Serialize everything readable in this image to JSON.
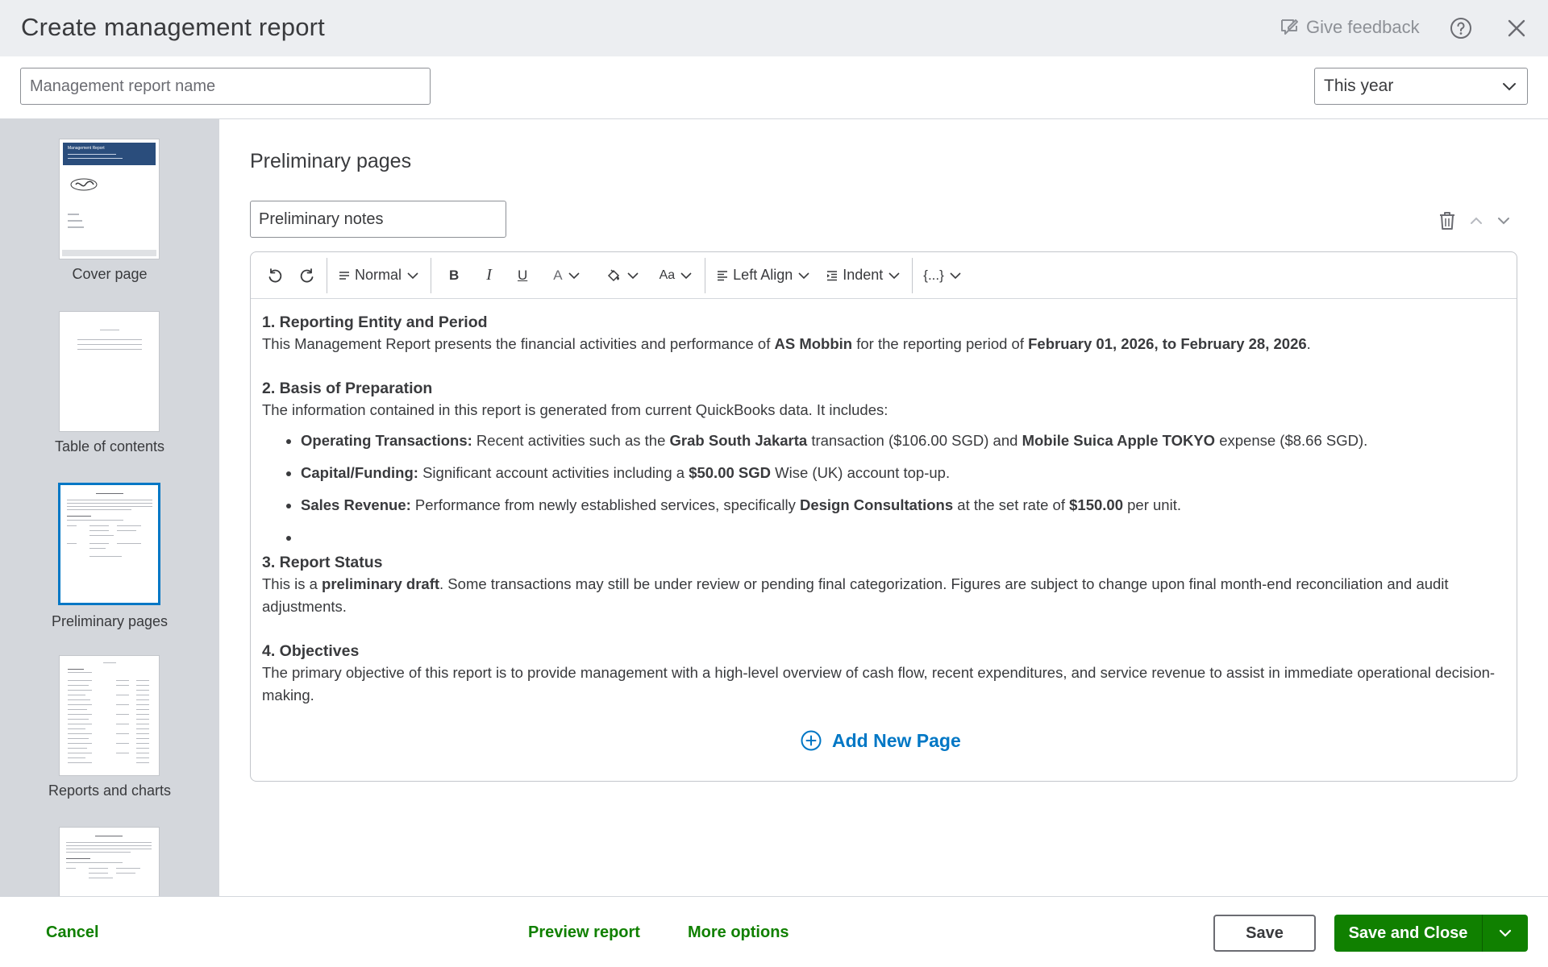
{
  "header": {
    "title": "Create management report",
    "feedback_label": "Give feedback"
  },
  "name_row": {
    "name_placeholder": "Management report name",
    "name_value": "",
    "period_value": "This year"
  },
  "sidebar": {
    "items": [
      {
        "label": "Cover page"
      },
      {
        "label": "Table of contents"
      },
      {
        "label": "Preliminary pages",
        "active": true
      },
      {
        "label": "Reports and charts"
      },
      {
        "label": ""
      }
    ],
    "cover_thumb_title": "Management Report"
  },
  "main": {
    "section_title": "Preliminary pages",
    "page_name_value": "Preliminary notes",
    "toolbar": {
      "style_label": "Normal",
      "bold_label": "B",
      "italic_label": "I",
      "underline_label": "U",
      "font_color_label": "A",
      "font_size_label": "Aa",
      "align_label": "Left Align",
      "indent_label": "Indent",
      "fields_label": "{...}"
    },
    "content": {
      "s1_heading": "1. Reporting Entity and Period",
      "s1_a": "This Management Report presents the financial activities and performance of ",
      "s1_b": "AS Mobbin",
      "s1_c": " for the reporting period of ",
      "s1_d": "February 01, 2026, to February 28, 2026",
      "s1_e": ".",
      "s2_heading": "2. Basis of Preparation",
      "s2_intro": "The information contained in this report is generated from current QuickBooks data. It includes:",
      "b1_label": "Operating Transactions:",
      "b1_a": " Recent activities such as the ",
      "b1_b": "Grab South Jakarta",
      "b1_c": " transaction ($106.00 SGD) and ",
      "b1_d": "Mobile Suica Apple TOKYO",
      "b1_e": " expense ($8.66 SGD).",
      "b2_label": "Capital/Funding:",
      "b2_a": " Significant account activities including a ",
      "b2_b": "$50.00 SGD",
      "b2_c": " Wise (UK) account top-up.",
      "b3_label": "Sales Revenue:",
      "b3_a": " Performance from newly established services, specifically ",
      "b3_b": "Design Consultations",
      "b3_c": " at the set rate of ",
      "b3_d": "$150.00",
      "b3_e": " per unit.",
      "s3_heading": "3. Report Status",
      "s3_a": "This is a ",
      "s3_b": "preliminary draft",
      "s3_c": ". Some transactions may still be under review or pending final categorization. Figures are subject to change upon final month-end reconciliation and audit adjustments.",
      "s4_heading": "4. Objectives",
      "s4_text": "The primary objective of this report is to provide management with a high-level overview of cash flow, recent expenditures, and service revenue to assist in immediate operational decision-making."
    },
    "add_page_label": "Add New Page"
  },
  "footer": {
    "cancel_label": "Cancel",
    "preview_label": "Preview report",
    "more_options_label": "More options",
    "save_label": "Save",
    "save_close_label": "Save and Close"
  },
  "colors": {
    "brand_green": "#108000",
    "link_blue": "#0077c5",
    "header_bg": "#eceef1",
    "sidebar_bg": "#d4d7dc",
    "cover_header_blue": "#2a4d7c"
  }
}
